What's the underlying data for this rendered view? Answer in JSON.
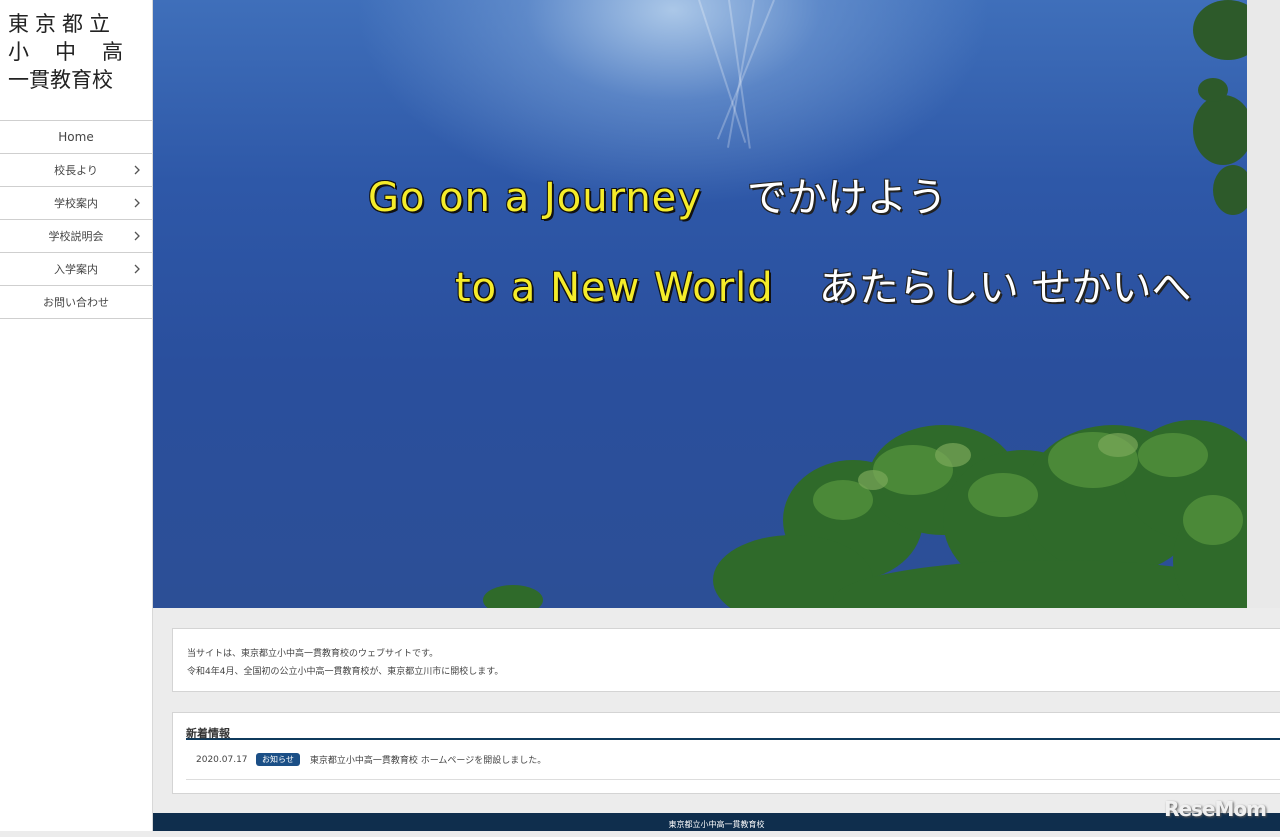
{
  "logo": {
    "line1": "東京都立",
    "line2": "小中高",
    "line3": "一貫教育校"
  },
  "nav": {
    "items": [
      {
        "label": "Home",
        "has_chevron": false
      },
      {
        "label": "校長より",
        "has_chevron": true
      },
      {
        "label": "学校案内",
        "has_chevron": true
      },
      {
        "label": "学校説明会",
        "has_chevron": true
      },
      {
        "label": "入学案内",
        "has_chevron": true
      },
      {
        "label": "お問い合わせ",
        "has_chevron": false
      }
    ]
  },
  "hero": {
    "line1_en": "Go on a Journey",
    "line1_ja": "でかけよう",
    "line2_en": "to a New World",
    "line2_ja": "あたらしい せかいへ",
    "en_color": "#f5ec2a",
    "ja_color": "#ffffff"
  },
  "about": {
    "line1": "当サイトは、東京都立小中高一貫教育校のウェブサイトです。",
    "line2": "令和4年4月、全国初の公立小中高一貫教育校が、東京都立川市に開校します。"
  },
  "news": {
    "title": "新着情報",
    "items": [
      {
        "date": "2020.07.17",
        "badge": "お知らせ",
        "text": "東京都立小中高一貫教育校 ホームページを開設しました。"
      }
    ]
  },
  "footer": {
    "text": "東京都立小中高一貫教育校"
  },
  "watermark": {
    "text": "ReseMom"
  }
}
